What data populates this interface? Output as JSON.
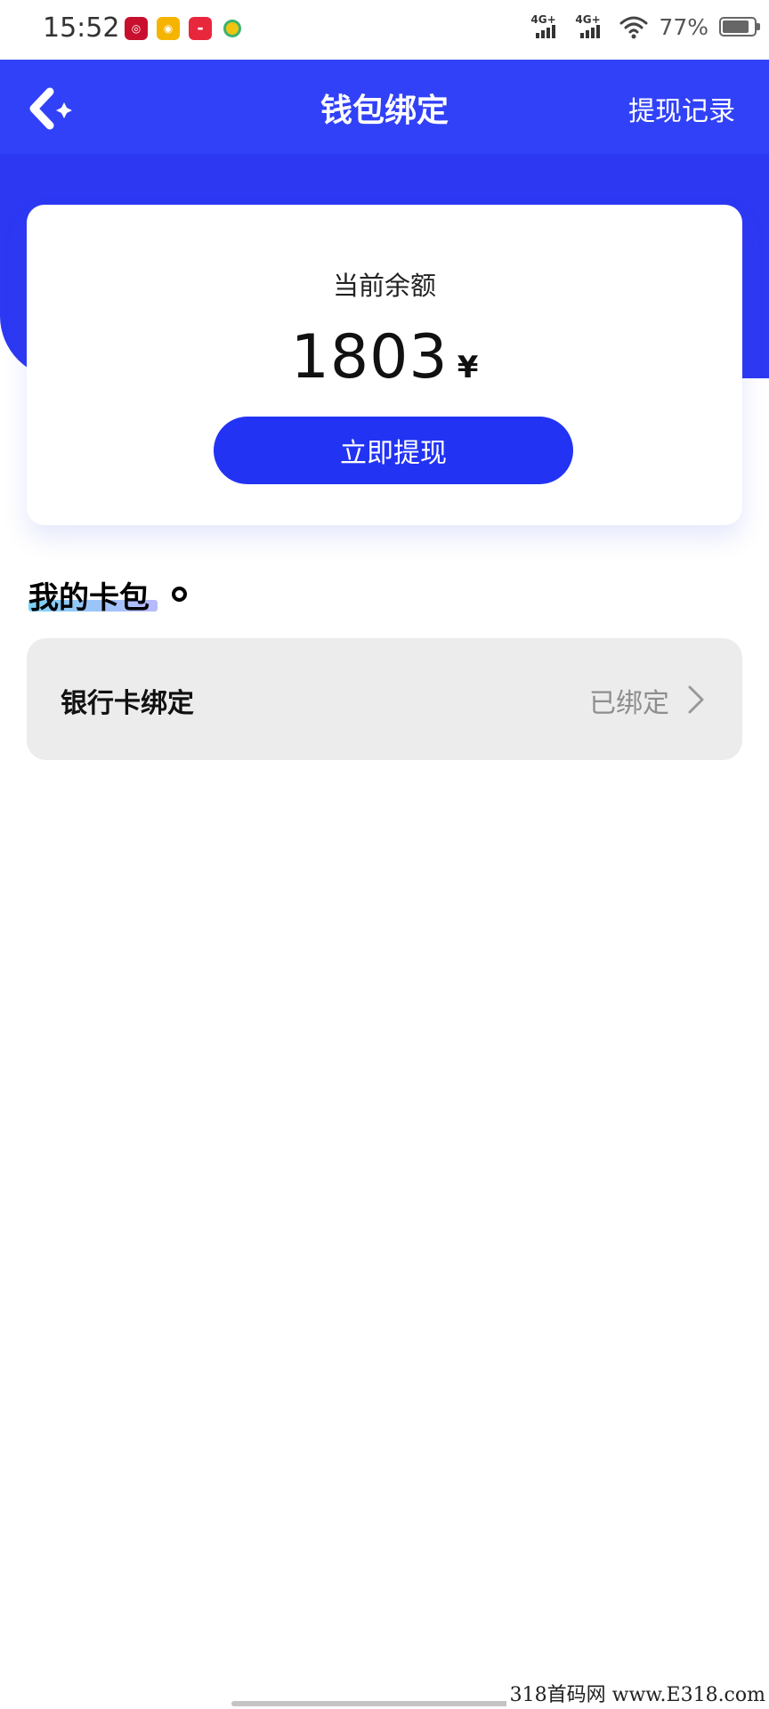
{
  "status_bar": {
    "time": "15:52",
    "network_1": "4G+",
    "network_2": "4G+",
    "battery": "77%",
    "battery_level": 0.77,
    "notification_icons": [
      "netease-music-icon",
      "weibo-icon",
      "xiaohongshu-icon",
      "qq-music-icon"
    ]
  },
  "header": {
    "title": "钱包绑定",
    "action": "提现记录",
    "back_icon": "back-arrow-icon"
  },
  "balance": {
    "label": "当前余额",
    "amount": "1803",
    "currency": "¥",
    "withdraw_label": "立即提现"
  },
  "section": {
    "title": "我的卡包"
  },
  "bank_card": {
    "label": "银行卡绑定",
    "status": "已绑定"
  },
  "watermark": "318首码网  www.E318.com",
  "colors": {
    "primary": "#2c38f2",
    "button": "#2233f4",
    "card_item_bg": "#ececec",
    "muted_text": "#8e8e8e"
  }
}
